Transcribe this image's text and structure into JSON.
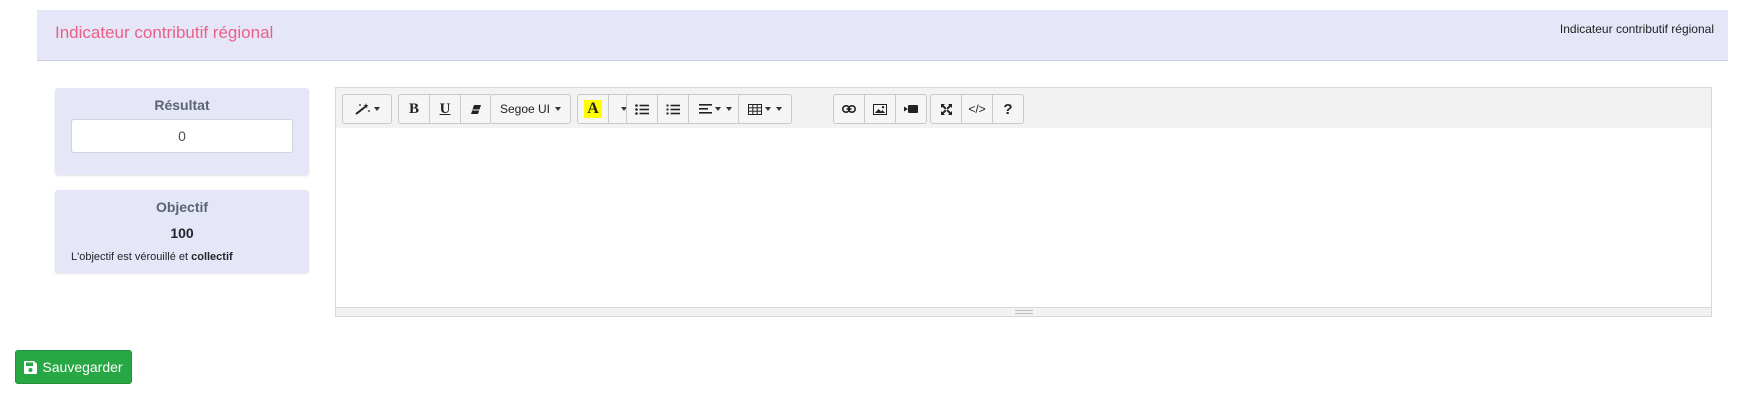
{
  "header": {
    "title": "Indicateur contributif régional",
    "breadcrumb": "Indicateur contributif régional"
  },
  "result_card": {
    "title": "Résultat",
    "value": "0"
  },
  "objective_card": {
    "title": "Objectif",
    "value": "100",
    "note_prefix": "L'objectif est vérouillé et ",
    "note_bold": "collectif"
  },
  "editor": {
    "toolbar": {
      "font_name": "Segoe UI",
      "highlight_letter": "A",
      "bold_letter": "B",
      "underline_letter": "U",
      "help_label": "?",
      "code_label": "</>"
    },
    "content": ""
  },
  "actions": {
    "save_label": "Sauvegarder"
  },
  "colors": {
    "header_bg": "#e5e6f8",
    "title_pink": "#ec5f87",
    "save_green": "#28a745",
    "highlight_yellow": "#ffff00"
  }
}
